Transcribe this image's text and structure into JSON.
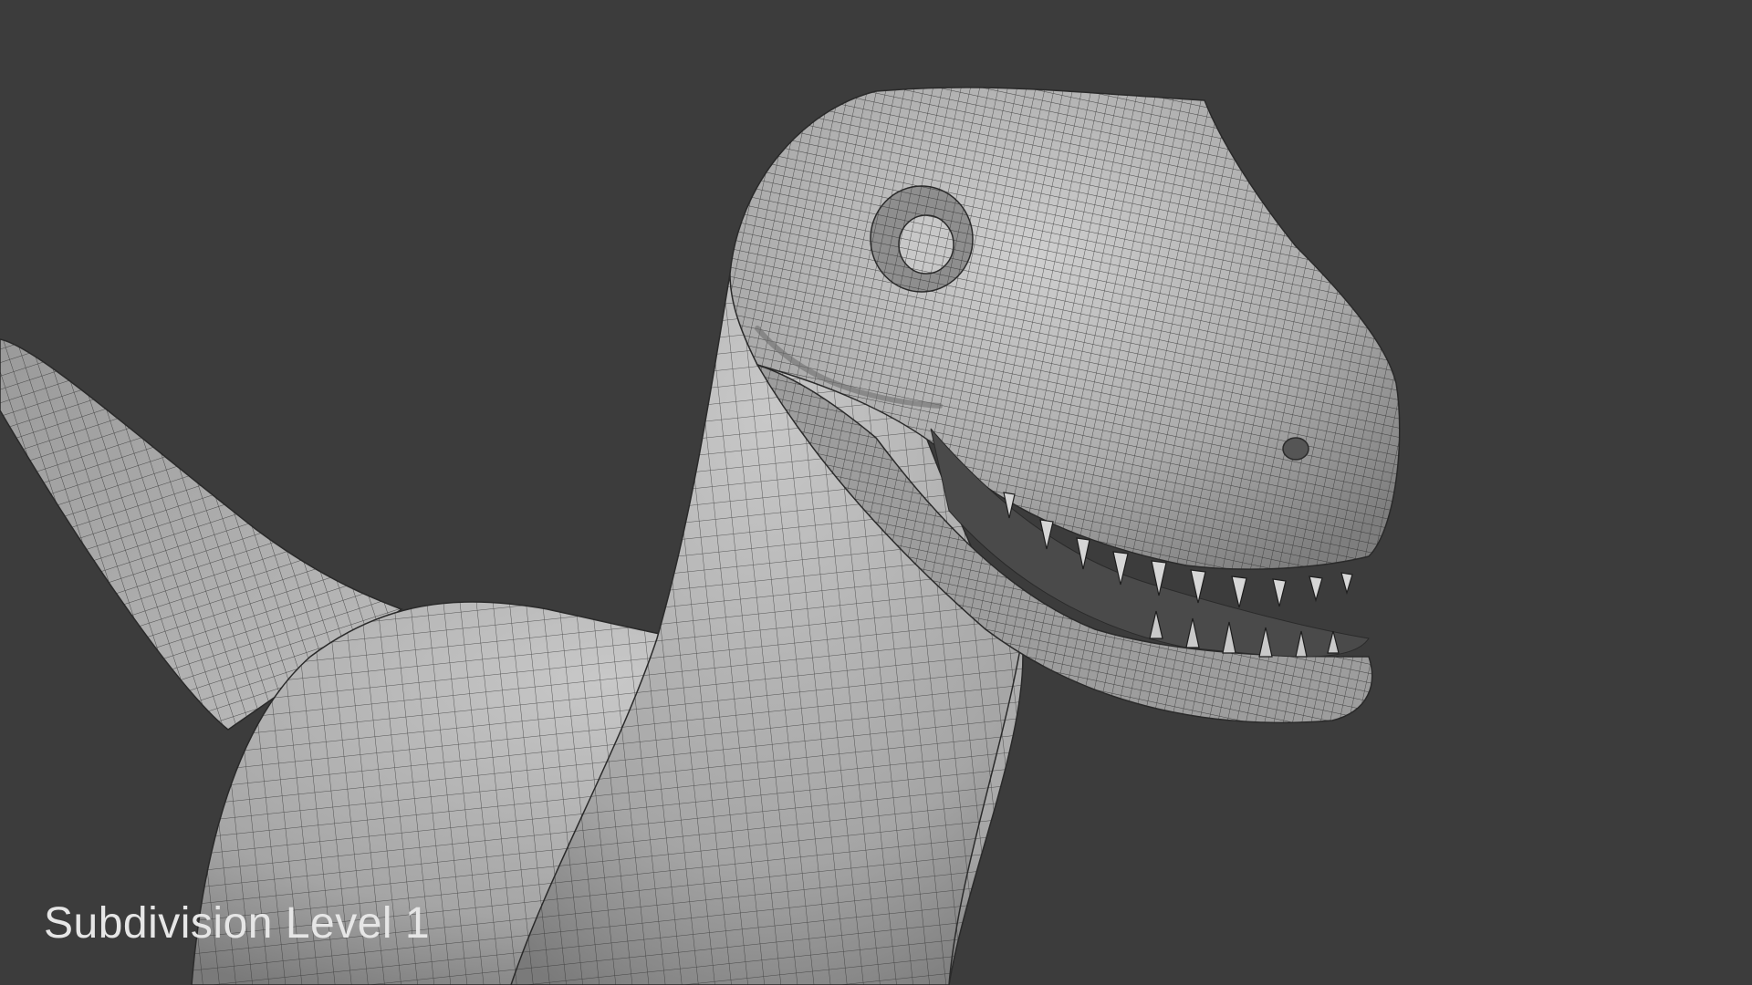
{
  "viewport": {
    "background_color": "#3c3c3c",
    "caption": "Subdivision Level 1"
  },
  "model": {
    "surface_color": "#b8b8b8",
    "wire_color": "#2a2a2a"
  }
}
